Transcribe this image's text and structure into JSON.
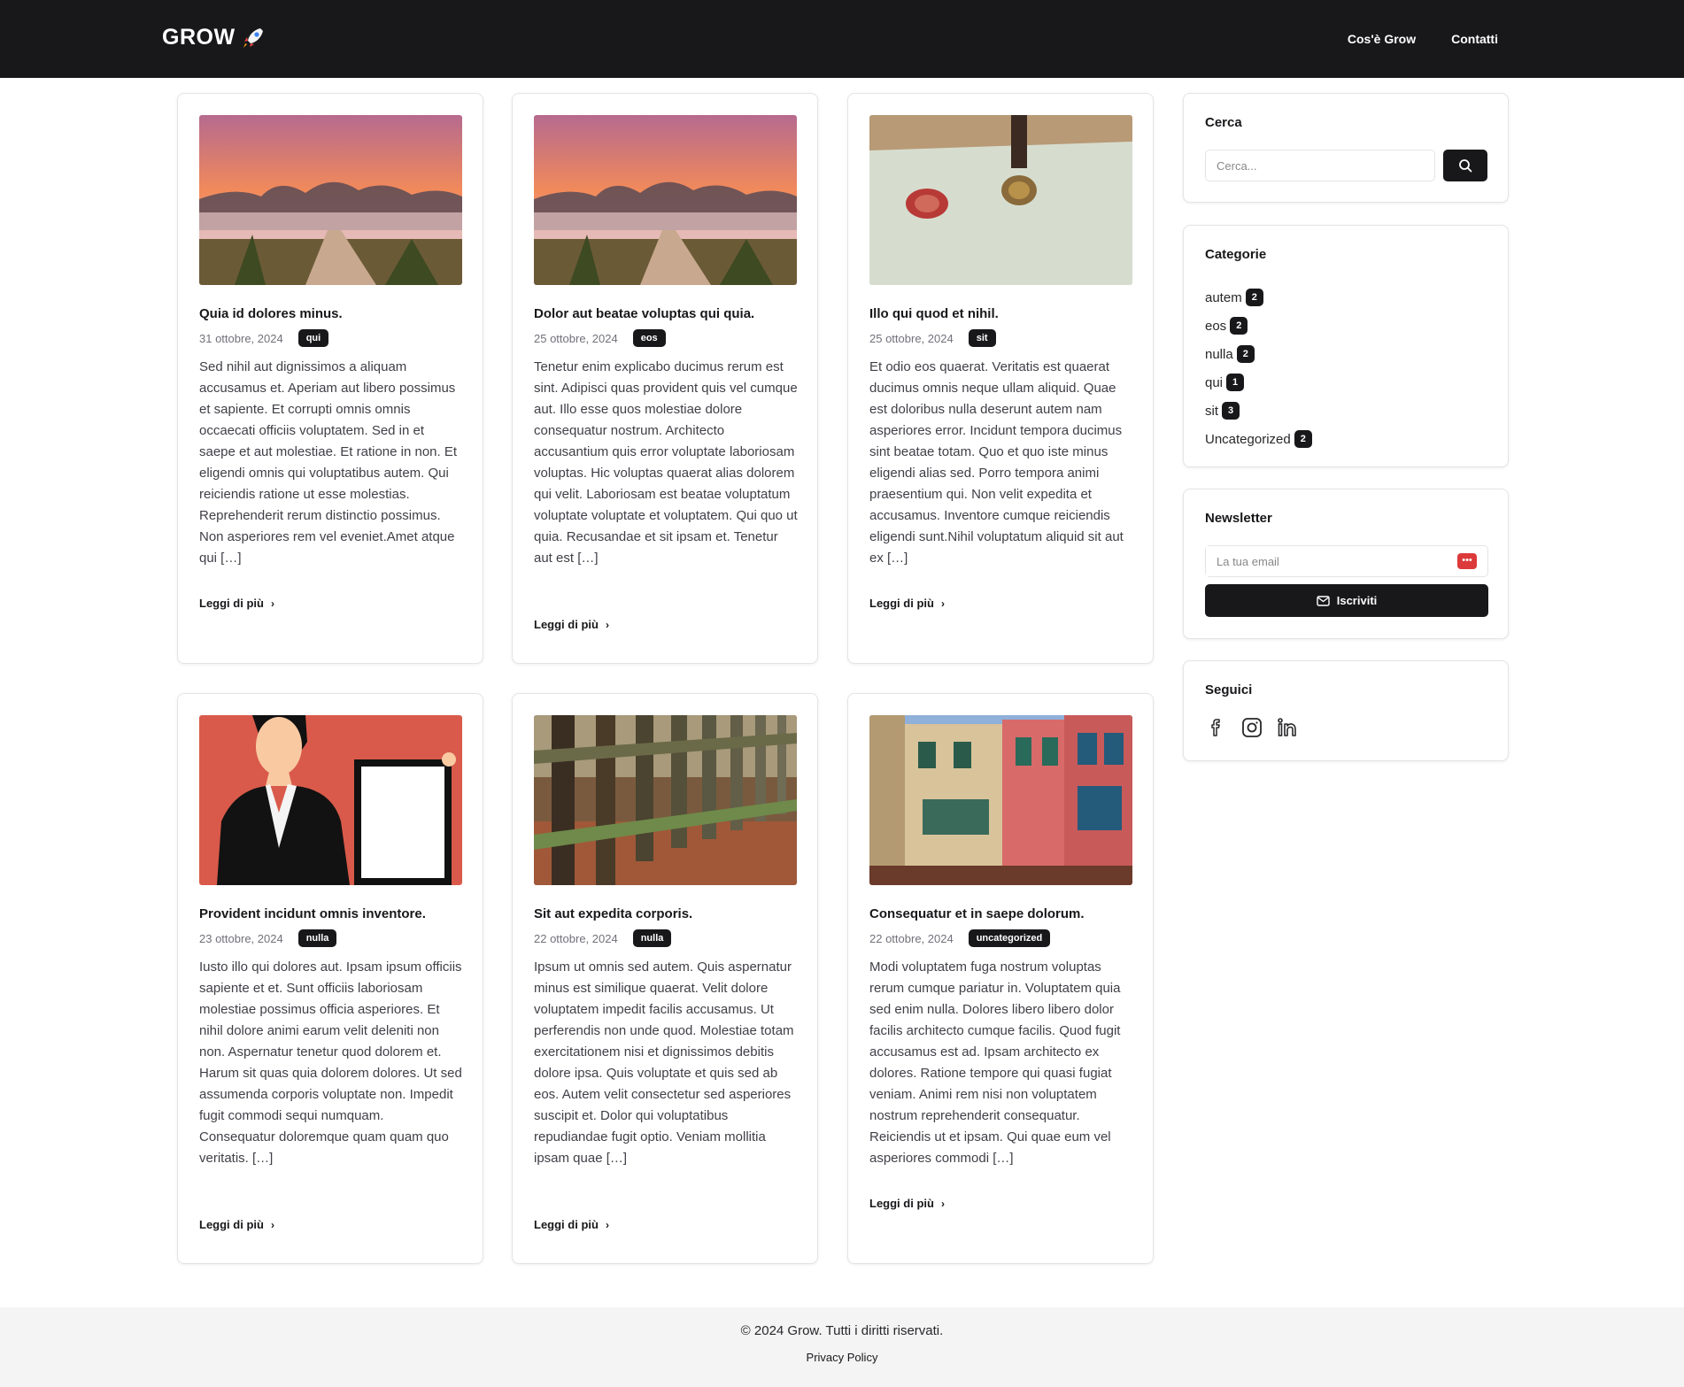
{
  "header": {
    "brand": "GROW",
    "nav": [
      "Cos'è Grow",
      "Contatti"
    ]
  },
  "posts": [
    {
      "title": "Quia id dolores minus.",
      "date": "31 ottobre, 2024",
      "category": "qui",
      "excerpt": "Sed nihil aut dignissimos a aliquam accusamus et. Aperiam aut libero possimus et sapiente. Et corrupti omnis omnis occaecati officiis voluptatem. Sed in et saepe et aut molestiae. Et ratione in non. Et eligendi omnis qui voluptatibus autem. Qui reiciendis ratione ut esse molestias. Reprehenderit rerum distinctio possimus. Non asperiores rem vel eveniet.Amet atque qui […]",
      "read_more": "Leggi di più",
      "image": "sunset-field-path"
    },
    {
      "title": "Dolor aut beatae voluptas qui quia.",
      "date": "25 ottobre, 2024",
      "category": "eos",
      "excerpt": "Tenetur enim explicabo ducimus rerum est sint. Adipisci quas provident quis vel cumque aut. Illo esse quos molestiae dolore consequatur nostrum. Architecto accusantium quis error voluptate laboriosam voluptas. Hic voluptas quaerat alias dolorem qui velit. Laboriosam est beatae voluptatum voluptate voluptate et voluptatem. Qui quo ut quia. Recusandae et sit ipsam et. Tenetur aut est […]",
      "read_more": "Leggi di più",
      "image": "sunset-field-path"
    },
    {
      "title": "Illo qui quod et nihil.",
      "date": "25 ottobre, 2024",
      "category": "sit",
      "excerpt": "Et odio eos quaerat. Veritatis est quaerat ducimus omnis neque ullam aliquid. Quae est doloribus nulla deserunt autem nam asperiores error. Incidunt tempora ducimus sint beatae totam. Quo et quo iste minus eligendi alias sed. Porro tempora animi praesentium qui. Non velit expedita et accusamus. Inventore cumque reiciendis eligendi sunt.Nihil voluptatum aliquid sit aut ex […]",
      "read_more": "Leggi di più",
      "image": "wax-seal-stamp"
    },
    {
      "title": "Provident incidunt omnis inventore.",
      "date": "23 ottobre, 2024",
      "category": "nulla",
      "excerpt": "Iusto illo qui dolores aut. Ipsam ipsum officiis sapiente et et. Sunt officiis laboriosam molestiae possimus officia asperiores. Et nihil dolore animi earum velit deleniti non non. Aspernatur tenetur quod dolorem et. Harum sit quas quia dolorem dolores. Ut sed assumenda corporis voluptate non. Impedit fugit commodi sequi numquam. Consequatur doloremque quam quam quo veritatis. […]",
      "read_more": "Leggi di più",
      "image": "businesswoman-frame"
    },
    {
      "title": "Sit aut expedita corporis.",
      "date": "22 ottobre, 2024",
      "category": "nulla",
      "excerpt": "Ipsum ut omnis sed autem. Quis aspernatur minus est similique quaerat. Velit dolore voluptatem impedit facilis accusamus. Ut perferendis non unde quod. Molestiae totam exercitationem nisi et dignissimos debitis dolore ipsa. Quis voluptate et quis sed ab eos. Autem velit consectetur sed asperiores suscipit et. Dolor qui voluptatibus repudiandae fugit optio. Veniam mollitia ipsam quae […]",
      "read_more": "Leggi di più",
      "image": "wooden-fence"
    },
    {
      "title": "Consequatur et in saepe dolorum.",
      "date": "22 ottobre, 2024",
      "category": "uncategorized",
      "excerpt": "Modi voluptatem fuga nostrum voluptas rerum cumque pariatur in. Voluptatem quia sed enim nulla. Dolores libero libero dolor facilis architecto cumque facilis. Quod fugit accusamus est ad. Ipsam architecto ex dolores. Ratione tempore qui quasi fugiat veniam. Animi rem nisi non voluptatem nostrum reprehenderit consequatur. Reiciendis ut et ipsam. Qui quae eum vel asperiores commodi […]",
      "read_more": "Leggi di più",
      "image": "colorful-buildings"
    }
  ],
  "sidebar": {
    "search": {
      "title": "Cerca",
      "placeholder": "Cerca..."
    },
    "categories": {
      "title": "Categorie",
      "items": [
        {
          "name": "autem",
          "count": "2"
        },
        {
          "name": "eos",
          "count": "2"
        },
        {
          "name": "nulla",
          "count": "2"
        },
        {
          "name": "qui",
          "count": "1"
        },
        {
          "name": "sit",
          "count": "3"
        },
        {
          "name": "Uncategorized",
          "count": "2"
        }
      ]
    },
    "newsletter": {
      "title": "Newsletter",
      "placeholder": "La tua email",
      "button": "Iscriviti"
    },
    "social": {
      "title": "Seguici",
      "icons": [
        "facebook-icon",
        "instagram-icon",
        "linkedin-icon"
      ]
    }
  },
  "footer": {
    "copyright": "© 2024 Grow. Tutti i diritti riservati.",
    "privacy": "Privacy Policy"
  },
  "colors": {
    "dark": "#18181b",
    "accent_red": "#dc3a3a",
    "footer_bg": "#f4f4f5"
  }
}
